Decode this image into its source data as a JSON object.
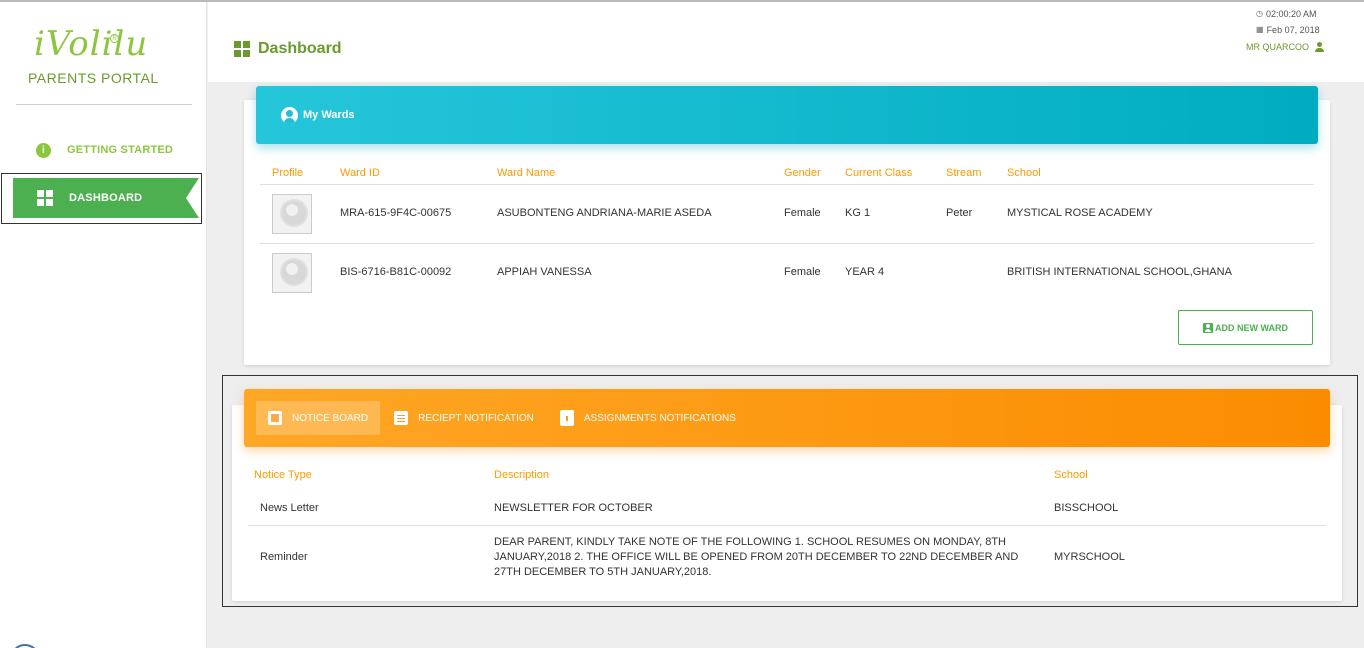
{
  "brand": {
    "logo_text": "iVolilu",
    "portal_label": "PARENTS PORTAL"
  },
  "sidebar": {
    "items": [
      {
        "label": "GETTING STARTED",
        "icon": "info-icon",
        "active": false
      },
      {
        "label": "DASHBOARD",
        "icon": "dashboard-icon",
        "active": true
      }
    ]
  },
  "header": {
    "title": "Dashboard",
    "time": "02:00:20 AM",
    "date": "Feb 07, 2018",
    "user_name": "MR QUARCOO"
  },
  "wards": {
    "title": "My Wards",
    "columns": [
      "Profile",
      "Ward ID",
      "Ward Name",
      "Gender",
      "Current Class",
      "Stream",
      "School"
    ],
    "rows": [
      {
        "ward_id": "MRA-615-9F4C-00675",
        "name": "ASUBONTENG ANDRIANA-MARIE ASEDA",
        "gender": "Female",
        "class": "KG 1",
        "stream": "Peter",
        "school": "MYSTICAL ROSE ACADEMY"
      },
      {
        "ward_id": "BIS-6716-B81C-00092",
        "name": "APPIAH VANESSA",
        "gender": "Female",
        "class": "YEAR 4",
        "stream": "",
        "school": "BRITISH INTERNATIONAL SCHOOL,GHANA"
      }
    ],
    "add_button": "ADD NEW WARD"
  },
  "notices": {
    "tabs": [
      {
        "label": "NOTICE BOARD",
        "active": true
      },
      {
        "label": "RECIEPT NOTIFICATION",
        "active": false
      },
      {
        "label": "ASSIGNMENTS NOTIFICATIONS",
        "active": false
      }
    ],
    "columns": [
      "Notice Type",
      "Description",
      "School"
    ],
    "rows": [
      {
        "type": "News Letter",
        "description": "NEWSLETTER FOR OCTOBER",
        "school": "BISSCHOOL"
      },
      {
        "type": "Reminder",
        "description": "DEAR PARENT, KINDLY TAKE NOTE OF THE FOLLOWING 1. SCHOOL RESUMES ON MONDAY, 8TH JANUARY,2018 2. THE OFFICE WILL BE OPENED FROM 20TH DECEMBER TO 22ND DECEMBER AND 27TH DECEMBER TO 5TH JANUARY,2018.",
        "school": "MYRSCHOOL"
      }
    ]
  },
  "colors": {
    "brand_green": "#8cc63f",
    "active_green": "#4caf50",
    "cyan_header": "#00acc1",
    "orange_header": "#fb8c00",
    "table_header_text": "#ff9800"
  }
}
